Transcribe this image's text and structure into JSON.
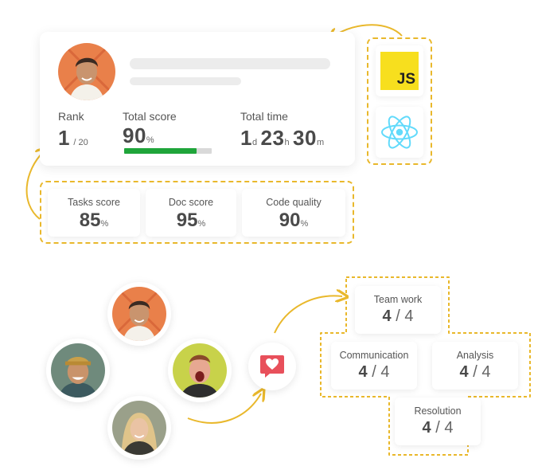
{
  "profile": {
    "rank_label": "Rank",
    "rank_value": "1",
    "rank_total": "/ 20",
    "total_score_label": "Total score",
    "total_score_value": "90",
    "total_score_unit": "%",
    "total_score_progress": 0.83,
    "total_time_label": "Total time",
    "time_days": "1",
    "time_days_unit": "d",
    "time_hours": "23",
    "time_hours_unit": "h",
    "time_minutes": "30",
    "time_minutes_unit": "m"
  },
  "tech_stack": [
    {
      "name": "JavaScript",
      "badge": "JS",
      "color": "#f7df1e"
    },
    {
      "name": "React",
      "icon": "react-icon",
      "color": "#61dafb"
    }
  ],
  "scores": [
    {
      "label": "Tasks score",
      "value": "85",
      "unit": "%"
    },
    {
      "label": "Doc score",
      "value": "95",
      "unit": "%"
    },
    {
      "label": "Code quality",
      "value": "90",
      "unit": "%"
    }
  ],
  "soft_skills": [
    {
      "label": "Team work",
      "score": "4",
      "max": "/ 4"
    },
    {
      "label": "Communication",
      "score": "4",
      "max": "/ 4"
    },
    {
      "label": "Analysis",
      "score": "4",
      "max": "/ 4"
    },
    {
      "label": "Resolution",
      "score": "4",
      "max": "/ 4"
    }
  ],
  "colors": {
    "accent": "#e9b82c",
    "progress": "#1fa53a",
    "heart": "#e8505b"
  },
  "icons": [
    "heart-chat-icon",
    "react-icon",
    "javascript-logo"
  ]
}
